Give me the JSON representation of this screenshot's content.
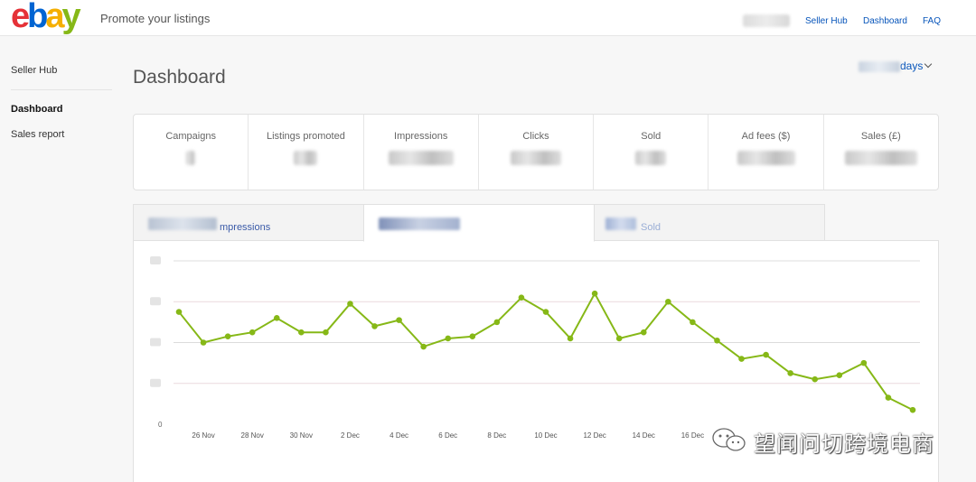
{
  "header": {
    "logo_letters": [
      "e",
      "b",
      "a",
      "y"
    ],
    "promote_label": "Promote your listings",
    "links": {
      "seller_hub": "Seller Hub",
      "dashboard": "Dashboard",
      "faq": "FAQ"
    }
  },
  "sidebar": {
    "seller_hub": "Seller Hub",
    "dashboard": "Dashboard",
    "sales_report": "Sales report"
  },
  "page_title": "Dashboard",
  "date_range_suffix": "days",
  "stats": {
    "campaigns": "Campaigns",
    "listings_promoted": "Listings promoted",
    "impressions": "Impressions",
    "clicks": "Clicks",
    "sold": "Sold",
    "ad_fees": "Ad fees ($)",
    "sales": "Sales (£)"
  },
  "tabs": {
    "impressions_suffix": "mpressions",
    "sold_suffix": "Sold"
  },
  "watermark": "望闻问切跨境电商",
  "colors": {
    "line": "#86b817",
    "accent_link": "#0654ba"
  },
  "chart_data": {
    "type": "line",
    "x_ticks": [
      "26 Nov",
      "28 Nov",
      "30 Nov",
      "2 Dec",
      "4 Dec",
      "6 Dec",
      "8 Dec",
      "10 Dec",
      "12 Dec",
      "14 Dec",
      "16 Dec"
    ],
    "y_min_label": "0",
    "ylim": [
      0,
      4
    ],
    "grid": true,
    "series": [
      {
        "values": [
          2.75,
          2.0,
          2.15,
          2.25,
          2.6,
          2.25,
          2.25,
          2.95,
          2.4,
          2.55,
          1.9,
          2.1,
          2.15,
          2.5,
          3.1,
          2.75,
          2.1,
          3.2,
          2.1,
          2.25,
          3.0,
          2.5,
          2.05,
          1.6,
          1.7,
          1.25,
          1.1,
          1.2,
          1.5,
          0.65,
          0.35
        ]
      }
    ]
  }
}
